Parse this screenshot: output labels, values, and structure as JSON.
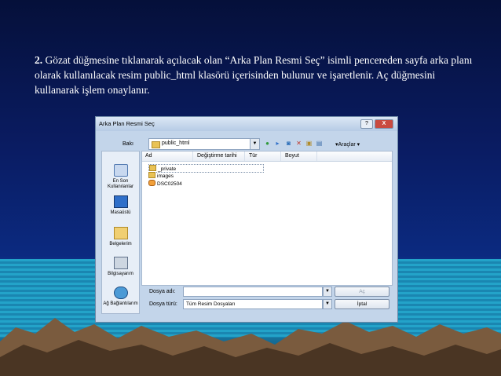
{
  "caption": {
    "number": "2.",
    "text": "Gözat düğmesine tıklanarak açılacak olan “Arka Plan Resmi Seç” isimli pencereden sayfa arka planı olarak kullanılacak resim public_html klasörü içerisinden bulunur ve işaretlenir. Aç düğmesini kullanarak işlem onaylanır."
  },
  "dialog": {
    "title": "Arka Plan Resmi Seç",
    "help_label": "?",
    "close_label": "X",
    "look_in_label": "Bakı",
    "look_in_value": "public_html",
    "tools_label": "▾Araçlar ▾",
    "places": [
      {
        "label": "En Son Kullanılanlar",
        "icon": "recent-icon"
      },
      {
        "label": "Masaüstü",
        "icon": "desktop-icon"
      },
      {
        "label": "Belgelerim",
        "icon": "documents-icon"
      },
      {
        "label": "Bilgisayarım",
        "icon": "computer-icon"
      },
      {
        "label": "Ağ Bağlantılarım",
        "icon": "network-icon"
      }
    ],
    "columns": [
      "Ad",
      "Değiştirme tarihi",
      "Tür",
      "Boyut"
    ],
    "files": [
      {
        "name": "_private",
        "type": "folder"
      },
      {
        "name": "images",
        "type": "folder"
      },
      {
        "name": "DSC02504",
        "type": "image"
      }
    ],
    "file_name_label": "Dosya adı:",
    "file_name_value": "",
    "file_type_label": "Dosya türü:",
    "file_type_value": "Tüm Resim Dosyaları",
    "open_button": "Aç",
    "cancel_button": "İptal"
  }
}
